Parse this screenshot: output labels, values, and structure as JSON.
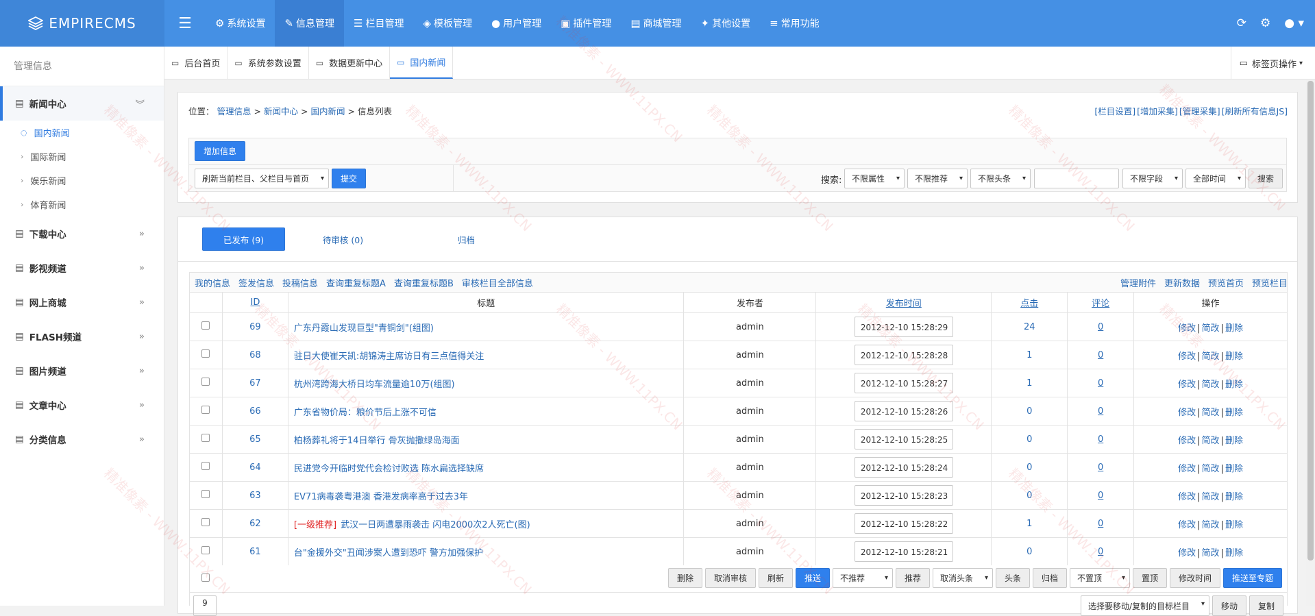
{
  "app": {
    "logo": "EMPIRECMS"
  },
  "topnav": [
    {
      "icon": "gear-icon",
      "glyph": "⚙",
      "label": "系统设置",
      "active": false
    },
    {
      "icon": "edit-icon",
      "glyph": "✎",
      "label": "信息管理",
      "active": true
    },
    {
      "icon": "list-icon",
      "glyph": "☰",
      "label": "栏目管理",
      "active": false
    },
    {
      "icon": "layers-icon",
      "glyph": "◈",
      "label": "模板管理",
      "active": false
    },
    {
      "icon": "user-icon",
      "glyph": "●",
      "label": "用户管理",
      "active": false
    },
    {
      "icon": "plugin-icon",
      "glyph": "▣",
      "label": "插件管理",
      "active": false
    },
    {
      "icon": "cart-icon",
      "glyph": "▤",
      "label": "商城管理",
      "active": false
    },
    {
      "icon": "wrench-icon",
      "glyph": "✦",
      "label": "其他设置",
      "active": false
    },
    {
      "icon": "sliders-icon",
      "glyph": "≡",
      "label": "常用功能",
      "active": false
    }
  ],
  "sidebar": {
    "title": "管理信息",
    "groups": [
      {
        "label": "新闻中心",
        "open": true,
        "children": [
          "国内新闻",
          "国际新闻",
          "娱乐新闻",
          "体育新闻"
        ],
        "active_child": 0
      },
      {
        "label": "下载中心"
      },
      {
        "label": "影视频道"
      },
      {
        "label": "网上商城"
      },
      {
        "label": "FLASH频道"
      },
      {
        "label": "图片频道"
      },
      {
        "label": "文章中心"
      },
      {
        "label": "分类信息"
      }
    ]
  },
  "tabs": [
    "后台首页",
    "系统参数设置",
    "数据更新中心",
    "国内新闻"
  ],
  "tab_ops": "标签页操作",
  "breadcrumb": {
    "prefix": "位置：",
    "path": [
      "管理信息",
      "新闻中心",
      "国内新闻"
    ],
    "current": "信息列表",
    "sep": ">"
  },
  "quicklinks": [
    "[栏目设置]",
    "[增加采集]",
    "[管理采集]",
    "[刷新所有信息JS]"
  ],
  "toolbar": {
    "add_button": "增加信息",
    "refresh_select": "刷新当前栏目、父栏目与首页",
    "submit_button": "提交",
    "search_label": "搜索:",
    "search_selects": [
      "不限属性",
      "不限推荐",
      "不限头条"
    ],
    "field_select": "不限字段",
    "time_select": "全部时间",
    "search_button": "搜索"
  },
  "status_tabs": [
    {
      "label": "已发布 (9)",
      "active": true
    },
    {
      "label": "待审核 (0)",
      "active": false
    },
    {
      "label": "归档",
      "active": false
    }
  ],
  "filter_links": [
    "我的信息",
    "签发信息",
    "投稿信息",
    "查询重复标题A",
    "查询重复标题B",
    "审核栏目全部信息"
  ],
  "right_links": [
    "管理附件",
    "更新数据",
    "预览首页",
    "预览栏目"
  ],
  "table": {
    "headers": [
      "ID",
      "标题",
      "发布者",
      "发布时间",
      "点击",
      "评论",
      "操作"
    ],
    "rows": [
      {
        "id": "69",
        "prefix": "",
        "title": "广东丹霞山发现巨型\"青铜剑\"(组图)",
        "author": "admin",
        "time": "2012-12-10 15:28:29",
        "clicks": "24",
        "comments": "0"
      },
      {
        "id": "68",
        "prefix": "",
        "title": "驻日大使崔天凯:胡锦涛主席访日有三点值得关注",
        "author": "admin",
        "time": "2012-12-10 15:28:28",
        "clicks": "1",
        "comments": "0"
      },
      {
        "id": "67",
        "prefix": "",
        "title": "杭州湾跨海大桥日均车流量逾10万(组图)",
        "author": "admin",
        "time": "2012-12-10 15:28:27",
        "clicks": "1",
        "comments": "0"
      },
      {
        "id": "66",
        "prefix": "",
        "title": "广东省物价局：粮价节后上涨不可信",
        "author": "admin",
        "time": "2012-12-10 15:28:26",
        "clicks": "0",
        "comments": "0"
      },
      {
        "id": "65",
        "prefix": "",
        "title": "柏杨葬礼将于14日举行 骨灰抛撒绿岛海面",
        "author": "admin",
        "time": "2012-12-10 15:28:25",
        "clicks": "0",
        "comments": "0"
      },
      {
        "id": "64",
        "prefix": "",
        "title": "民进党今开临时党代会检讨败选 陈水扁选择缺席",
        "author": "admin",
        "time": "2012-12-10 15:28:24",
        "clicks": "0",
        "comments": "0"
      },
      {
        "id": "63",
        "prefix": "",
        "title": "EV71病毒袭粤港澳 香港发病率高于过去3年",
        "author": "admin",
        "time": "2012-12-10 15:28:23",
        "clicks": "0",
        "comments": "0"
      },
      {
        "id": "62",
        "prefix": "[一级推荐]",
        "title": "武汉一日两遭暴雨袭击 闪电2000次2人死亡(图)",
        "author": "admin",
        "time": "2012-12-10 15:28:22",
        "clicks": "1",
        "comments": "0"
      },
      {
        "id": "61",
        "prefix": "",
        "title": "台\"金援外交\"丑闻涉案人遭到恐吓 警方加强保护",
        "author": "admin",
        "time": "2012-12-10 15:28:21",
        "clicks": "0",
        "comments": "0"
      }
    ],
    "row_ops": [
      "修改",
      "简改",
      "删除"
    ],
    "op_sep": "|"
  },
  "bulk": {
    "buttons": [
      "删除",
      "取消审核",
      "刷新"
    ],
    "push_button": "推送",
    "recommend_select": "不推荐",
    "recommend_button": "推荐",
    "headline_select": "取消头条",
    "headline_button": "头条",
    "archive_button": "归档",
    "top_select": "不置顶",
    "top_button": "置顶",
    "time_button": "修改时间",
    "topic_button": "推送至专题"
  },
  "bottom": {
    "page_box": "9",
    "move_select": "选择要移动/复制的目标栏目",
    "move_button": "移动",
    "copy_button": "复制"
  },
  "watermark": "精准像素 - WWW.11PX.CN",
  "colors": {
    "topbar": "#4590e4",
    "accent": "#2f80ed",
    "link": "#2a6bb5",
    "recommend": "#e02020"
  }
}
